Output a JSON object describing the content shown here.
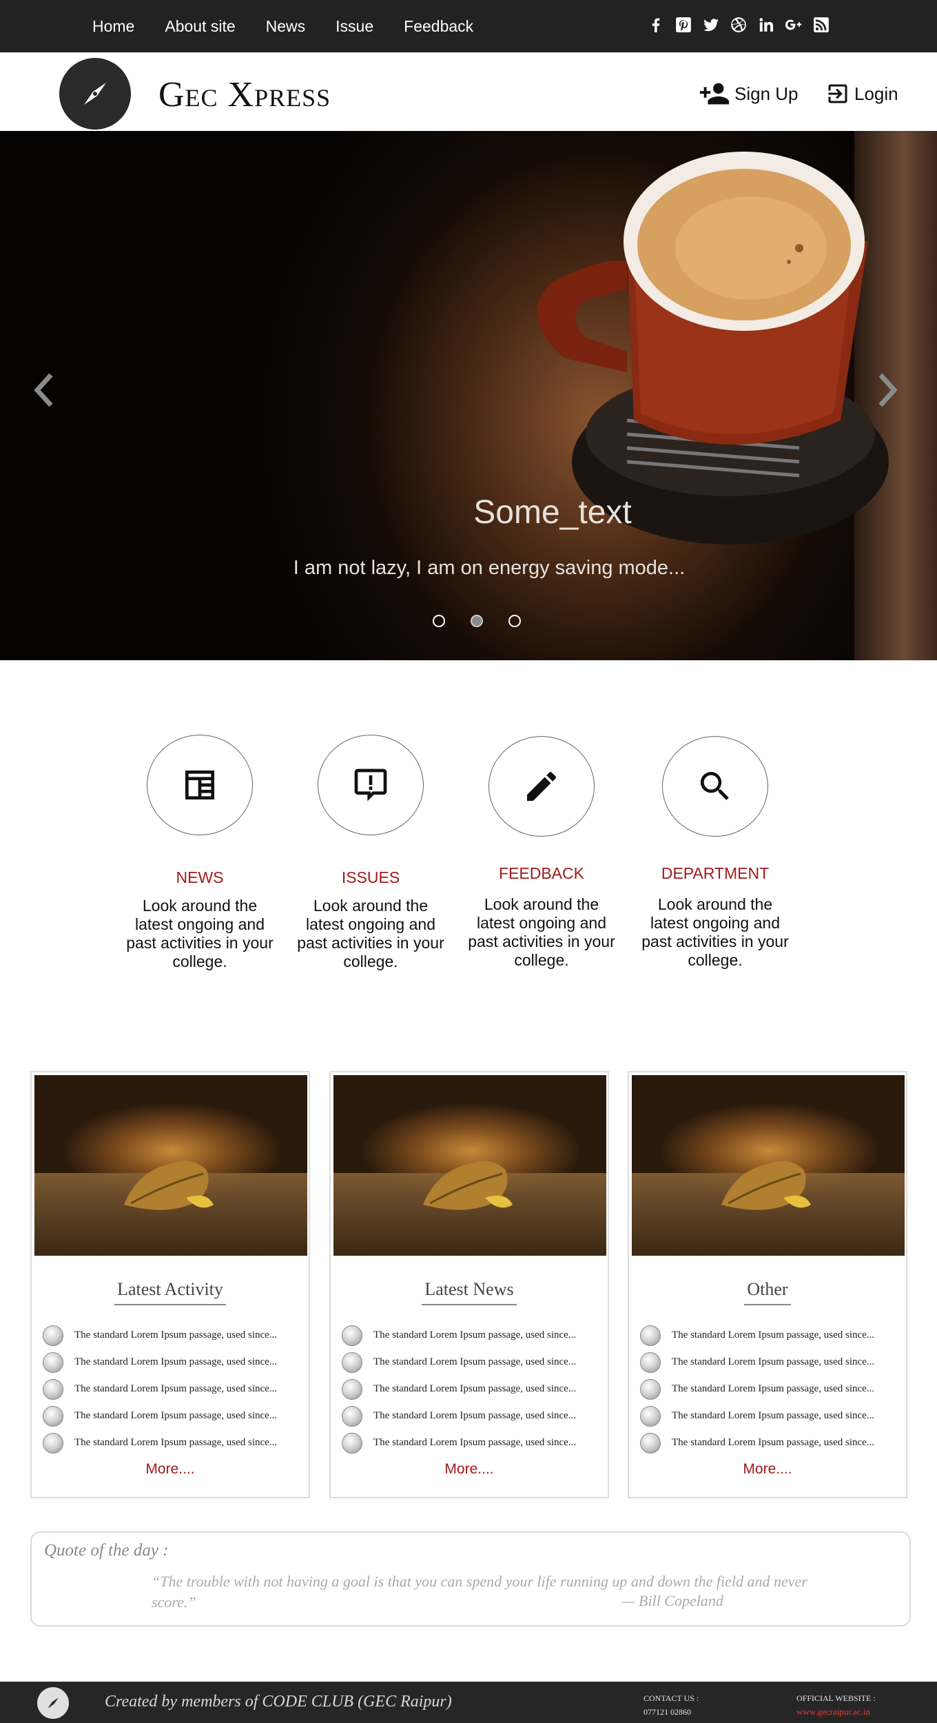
{
  "nav": {
    "links": [
      "Home",
      "About site",
      "News",
      "Issue",
      "Feedback"
    ],
    "social_icons": [
      "facebook-icon",
      "pinterest-icon",
      "twitter-icon",
      "dribbble-icon",
      "linkedin-icon",
      "google-plus-icon",
      "rss-icon"
    ]
  },
  "header": {
    "brand": "Gec Xpress",
    "signup_label": "Sign Up",
    "login_label": "Login"
  },
  "hero": {
    "title": "Some_text",
    "subtitle": "I am not lazy, I am on energy saving mode...",
    "slide_count": 3,
    "active_slide": 2
  },
  "features": [
    {
      "icon": "newspaper-icon",
      "title": "NEWS",
      "desc": "Look around the latest ongoing and past activities in your college."
    },
    {
      "icon": "alert-message-icon",
      "title": "ISSUES",
      "desc": "Look around the latest ongoing and past activities in your college."
    },
    {
      "icon": "pencil-icon",
      "title": "FEEDBACK",
      "desc": "Look around the latest ongoing and past activities in your college."
    },
    {
      "icon": "search-icon",
      "title": "DEPARTMENT",
      "desc": "Look around the latest ongoing and past activities in your college."
    }
  ],
  "cards": [
    {
      "title": "Latest Activity",
      "items": [
        "The standard Lorem Ipsum passage, used since...",
        "The standard Lorem Ipsum passage, used since...",
        "The standard Lorem Ipsum passage, used since...",
        "The standard Lorem Ipsum passage, used since...",
        "The standard Lorem Ipsum passage, used since..."
      ],
      "more": "More...."
    },
    {
      "title": "Latest News",
      "items": [
        "The standard Lorem Ipsum passage, used since...",
        "The standard Lorem Ipsum passage, used since...",
        "The standard Lorem Ipsum passage, used since...",
        "The standard Lorem Ipsum passage, used since...",
        "The standard Lorem Ipsum passage, used since..."
      ],
      "more": "More...."
    },
    {
      "title": "Other",
      "items": [
        "The standard Lorem Ipsum passage, used since...",
        "The standard Lorem Ipsum passage, used since...",
        "The standard Lorem Ipsum passage, used since...",
        "The standard Lorem Ipsum passage, used since...",
        "The standard Lorem Ipsum passage, used since..."
      ],
      "more": "More...."
    }
  ],
  "quote": {
    "label": "Quote of the day :",
    "text": "“The trouble with not having a goal is that you can spend your life running up and down the field and never score.”",
    "author": "— Bill Copeland"
  },
  "footer": {
    "credit": "Created by members of CODE CLUB (GEC Raipur)",
    "contact_label": "CONTACT US :",
    "contact_phone": "077121 02860",
    "official_label": "OFFICIAL WEBSITE :",
    "official_url": "www.gecraipur.ac.in"
  },
  "colors": {
    "nav_bg": "#222222",
    "accent": "#a3191b",
    "footer_bg": "#262626"
  }
}
